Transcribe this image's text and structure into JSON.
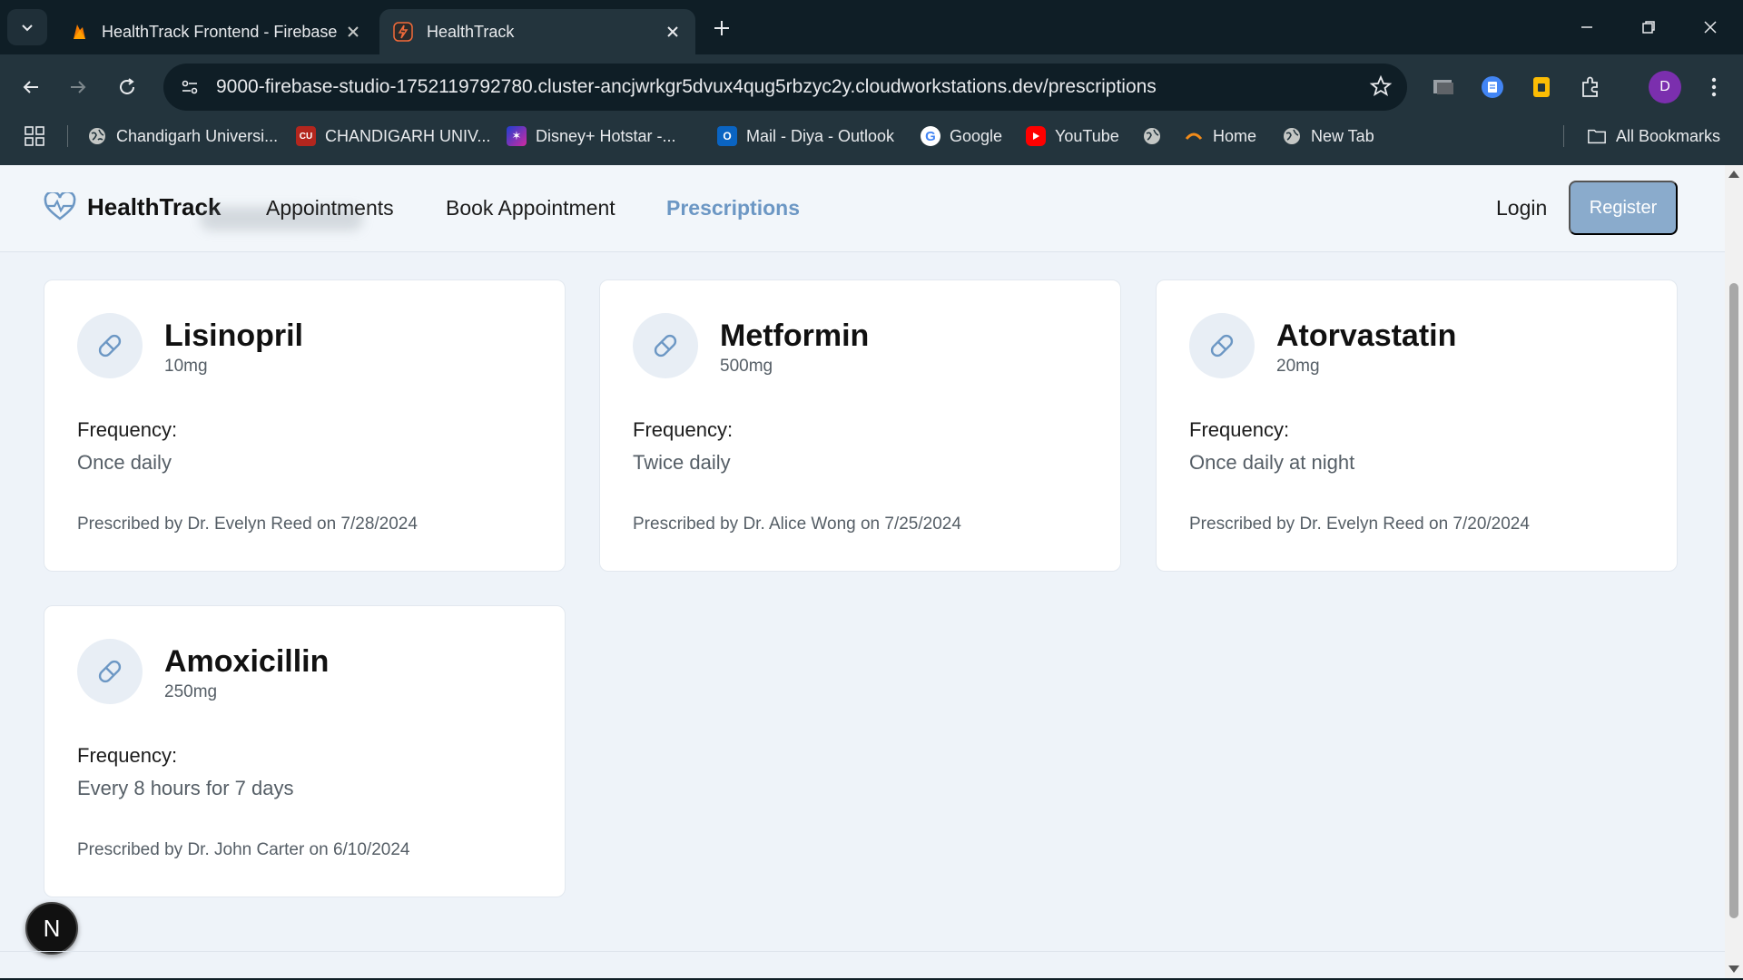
{
  "browser": {
    "tabs": [
      {
        "title": "HealthTrack Frontend - Firebase",
        "active": false
      },
      {
        "title": "HealthTrack",
        "active": true
      }
    ],
    "url": "9000-firebase-studio-1752119792780.cluster-ancjwrkgr5dvux4qug5rbzyc2y.cloudworkstations.dev/prescriptions",
    "profile_initial": "D",
    "bookmarks": [
      {
        "label": "Chandigarh Universi...",
        "icon": "globe-icon"
      },
      {
        "label": "CHANDIGARH UNIV...",
        "icon": "cu-logo-icon"
      },
      {
        "label": "Disney+ Hotstar -...",
        "icon": "hotstar-icon"
      },
      {
        "label": "Mail - Diya - Outlook",
        "icon": "outlook-icon"
      },
      {
        "label": "Google",
        "icon": "google-icon"
      },
      {
        "label": "YouTube",
        "icon": "youtube-icon"
      },
      {
        "label": "",
        "icon": "globe-icon"
      },
      {
        "label": "Home",
        "icon": "home-arc-icon"
      },
      {
        "label": "New Tab",
        "icon": "globe-icon"
      }
    ],
    "all_bookmarks_label": "All Bookmarks"
  },
  "app": {
    "brand": "HealthTrack",
    "nav": [
      {
        "label": "Appointments",
        "active": false
      },
      {
        "label": "Book Appointment",
        "active": false
      },
      {
        "label": "Prescriptions",
        "active": true
      }
    ],
    "login_label": "Login",
    "register_label": "Register",
    "accent_color": "#6c97c4"
  },
  "prescriptions": [
    {
      "name": "Lisinopril",
      "dose": "10mg",
      "frequency_label": "Frequency:",
      "frequency": "Once daily",
      "prescribed": "Prescribed by Dr. Evelyn Reed on 7/28/2024"
    },
    {
      "name": "Metformin",
      "dose": "500mg",
      "frequency_label": "Frequency:",
      "frequency": "Twice daily",
      "prescribed": "Prescribed by Dr. Alice Wong on 7/25/2024"
    },
    {
      "name": "Atorvastatin",
      "dose": "20mg",
      "frequency_label": "Frequency:",
      "frequency": "Once daily at night",
      "prescribed": "Prescribed by Dr. Evelyn Reed on 7/20/2024"
    },
    {
      "name": "Amoxicillin",
      "dose": "250mg",
      "frequency_label": "Frequency:",
      "frequency": "Every 8 hours for 7 days",
      "prescribed": "Prescribed by Dr. John Carter on 6/10/2024"
    }
  ],
  "dev_badge": "N"
}
